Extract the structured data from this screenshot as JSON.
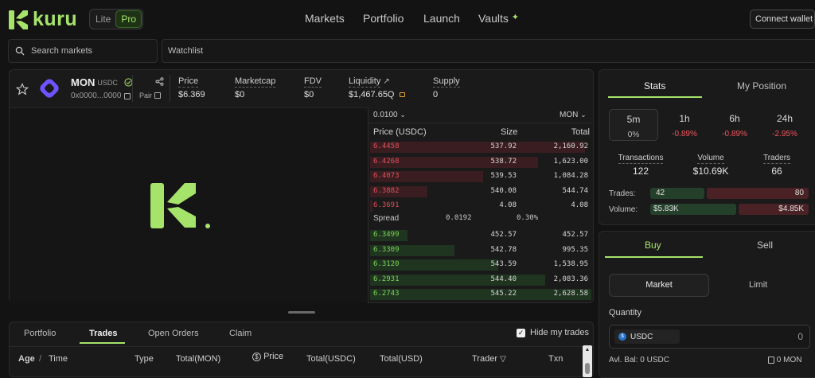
{
  "brand": {
    "name": "kuru",
    "accent": "#a6e36a"
  },
  "mode": {
    "lite": "Lite",
    "pro": "Pro"
  },
  "nav": {
    "items": [
      "Markets",
      "Portfolio",
      "Launch",
      "Vaults"
    ],
    "connect": "Connect wallet"
  },
  "search": {
    "placeholder": "Search markets",
    "watchlist": "Watchlist"
  },
  "market": {
    "symbol": "MON",
    "quote": "USDC",
    "address": "0x0000...0000",
    "pair_label": "Pair",
    "stats": [
      {
        "label": "Price",
        "value": "$6.369"
      },
      {
        "label": "Marketcap",
        "value": "$0"
      },
      {
        "label": "FDV",
        "value": "$0"
      },
      {
        "label": "Liquidity",
        "value": "$1,467.65Q"
      },
      {
        "label": "Supply",
        "value": "0"
      }
    ]
  },
  "orderbook": {
    "tick": "0.0100",
    "unit": "MON",
    "headers": {
      "price": "Price (USDC)",
      "size": "Size",
      "total": "Total"
    },
    "asks": [
      {
        "price": "6.4458",
        "size": "537.92",
        "total": "2,160.92",
        "depth": 0.97
      },
      {
        "price": "6.4268",
        "size": "538.72",
        "total": "1,623.00",
        "depth": 0.76
      },
      {
        "price": "6.4073",
        "size": "539.53",
        "total": "1,084.28",
        "depth": 0.51
      },
      {
        "price": "6.3882",
        "size": "540.08",
        "total": "544.74",
        "depth": 0.26
      },
      {
        "price": "6.3691",
        "size": "4.08",
        "total": "4.08",
        "depth": 0.01
      }
    ],
    "spread": {
      "label": "Spread",
      "value": "0.0192",
      "pct": "0.30%"
    },
    "bids": [
      {
        "price": "6.3499",
        "size": "452.57",
        "total": "452.57",
        "depth": 0.17
      },
      {
        "price": "6.3309",
        "size": "542.78",
        "total": "995.35",
        "depth": 0.38
      },
      {
        "price": "6.3120",
        "size": "543.59",
        "total": "1,538.95",
        "depth": 0.58
      },
      {
        "price": "6.2931",
        "size": "544.40",
        "total": "2,083.36",
        "depth": 0.79
      },
      {
        "price": "6.2743",
        "size": "545.22",
        "total": "2,628.58",
        "depth": 1.0
      }
    ]
  },
  "bottom": {
    "tabs": [
      "Portfolio",
      "Trades",
      "Open Orders",
      "Claim"
    ],
    "hide_label": "Hide my trades",
    "columns": [
      "Age",
      "Time",
      "Type",
      "Total(MON)",
      "Price",
      "Total(USDC)",
      "Total(USD)",
      "Trader",
      "Txn"
    ]
  },
  "stats": {
    "tabs": [
      "Stats",
      "My Position"
    ],
    "timeframes": [
      {
        "label": "5m",
        "value": "0%"
      },
      {
        "label": "1h",
        "value": "-0.89%"
      },
      {
        "label": "6h",
        "value": "-0.89%"
      },
      {
        "label": "24h",
        "value": "-2.95%"
      }
    ],
    "metrics": [
      {
        "label": "Transactions",
        "value": "122"
      },
      {
        "label": "Volume",
        "value": "$10.69K"
      },
      {
        "label": "Traders",
        "value": "66"
      }
    ],
    "trades_label": "Trades:",
    "trades_buy": "42",
    "trades_sell": "80",
    "volume_label": "Volume:",
    "volume_buy": "$5.83K",
    "volume_sell": "$4.85K"
  },
  "trade": {
    "tabs": [
      "Buy",
      "Sell"
    ],
    "order_types": [
      "Market",
      "Limit"
    ],
    "quantity_label": "Quantity",
    "token": "USDC",
    "amount": "0",
    "balance_label": "Avl. Bal:",
    "balance": "0 USDC",
    "balance_mon": "0 MON"
  }
}
